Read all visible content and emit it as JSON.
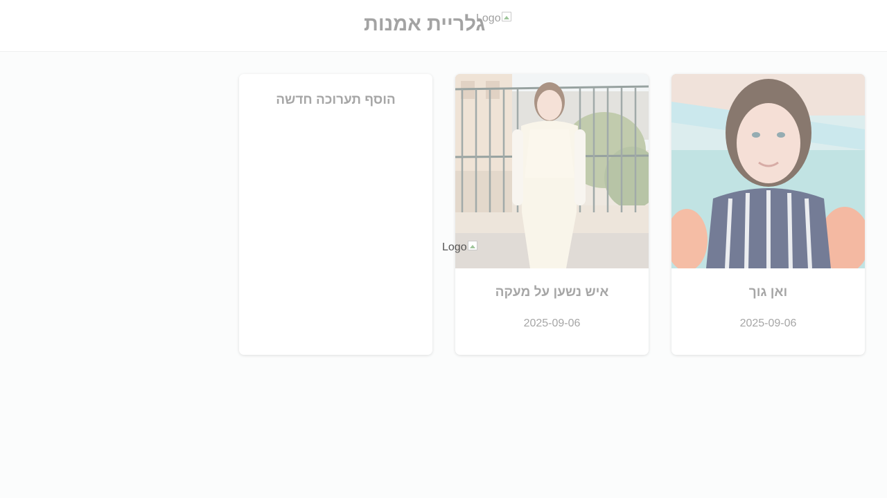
{
  "header": {
    "title": "גלריית אמנות",
    "logo_alt": "Logo"
  },
  "floating_logo_alt": "Logo",
  "add_card": {
    "label": "הוסף תערוכה חדשה"
  },
  "cards": [
    {
      "title": "ואן גוך",
      "date": "2025-09-06",
      "photo": "girl-in-pool-photo"
    },
    {
      "title": "איש נשען על מעקה",
      "date": "2025-09-06",
      "photo": "girl-on-balcony-photo"
    }
  ],
  "colors": {
    "background": "#fbfcfc",
    "card": "#ffffff",
    "muted_text": "#a6a6a6"
  }
}
